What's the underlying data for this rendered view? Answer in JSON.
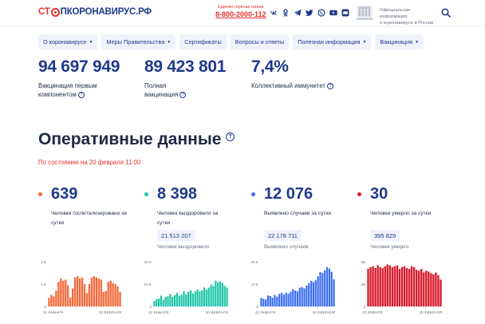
{
  "header": {
    "logo_part1": "СТ",
    "logo_part2": "ПКОРОНАВИРУС.РФ",
    "hotline_label": "Единая горячая линия",
    "hotline_phone": "8-800-2000-112",
    "social_icons": [
      "vk-icon",
      "ok-icon",
      "telegram-icon",
      "twitter-icon",
      "viber-icon",
      "youtube-icon",
      "tiktok-icon"
    ],
    "official_text": "Официальная информация\nо коронавирусе в России"
  },
  "nav": [
    {
      "label": "О коронавирусе",
      "dropdown": true
    },
    {
      "label": "Меры Правительства",
      "dropdown": true
    },
    {
      "label": "Сертификаты",
      "dropdown": false
    },
    {
      "label": "Вопросы и ответы",
      "dropdown": false
    },
    {
      "label": "Полезная информация",
      "dropdown": true
    },
    {
      "label": "Вакцинация",
      "dropdown": true
    }
  ],
  "vaccination": [
    {
      "value": "94 697 949",
      "label": "Вакцинация первым компонентом"
    },
    {
      "value": "89 423 801",
      "label": "Полная вакцинация"
    },
    {
      "value": "7,4%",
      "label": "Коллективный иммунитет"
    }
  ],
  "section": {
    "title": "Оперативные данные",
    "as_of": "По состоянию на 20 февраля 11:00"
  },
  "cards": [
    {
      "value": "639",
      "label": "Человек госпитализировано за сутки",
      "total": "",
      "total_label": "",
      "color": "#f26a3b"
    },
    {
      "value": "8 398",
      "label": "Человек выздоровело за сутки",
      "total": "21 513 207",
      "total_label": "Человек выздоровело",
      "color": "#1fc6a6"
    },
    {
      "value": "12 076",
      "label": "Выявлено случаев за сутки",
      "total": "22 178 711",
      "total_label": "Выявлено случаев",
      "color": "#3d6ff0"
    },
    {
      "value": "30",
      "label": "Человек умерло за сутки",
      "total": "395 829",
      "total_label": "Человек умерло",
      "color": "#d81b2b"
    }
  ],
  "chart_data": [
    {
      "type": "bar",
      "name": "hospitalized",
      "color": "#f26a3b",
      "y_ticks": [
        "2 K",
        "1 K",
        "0"
      ],
      "ylim": [
        0,
        2000
      ],
      "x_labels": [
        "21 ЯНВАРЯ",
        "20 ФЕВРАЛЯ"
      ],
      "values": [
        380,
        520,
        450,
        700,
        1100,
        1250,
        1150,
        1200,
        950,
        400,
        800,
        1300,
        1350,
        1250,
        1300,
        1000,
        600,
        1000,
        1300,
        1350,
        1300,
        1250,
        1200,
        650,
        700,
        1100,
        1150,
        1050,
        1000,
        900,
        639
      ]
    },
    {
      "type": "bar",
      "name": "recovered",
      "color": "#1fc6a6",
      "y_ticks": [
        "20 K",
        "10 K",
        "0"
      ],
      "ylim": [
        0,
        20000
      ],
      "x_labels": [
        "22 ЯНВАРЯ",
        "20 ФЕВРАЛЯ"
      ],
      "values": [
        2500,
        3200,
        3500,
        4800,
        3000,
        4300,
        4500,
        5600,
        4300,
        5000,
        6100,
        4800,
        5200,
        6800,
        5500,
        6500,
        7200,
        5800,
        6800,
        7600,
        6700,
        7200,
        8500,
        7500,
        8400,
        9800,
        9200,
        11500,
        10800,
        11200,
        10500,
        9300,
        8398
      ]
    },
    {
      "type": "bar",
      "name": "cases",
      "color": "#3d6ff0",
      "y_ticks": [
        "20 K",
        "10 K",
        "0"
      ],
      "ylim": [
        0,
        20000
      ],
      "x_labels": [
        "22 ЯНВАРЯ",
        "20 ФЕВРАЛЯ"
      ],
      "values": [
        3800,
        3400,
        3100,
        4900,
        4700,
        3900,
        5100,
        4400,
        5600,
        6100,
        5300,
        6200,
        5700,
        6600,
        7700,
        7100,
        6800,
        8400,
        8700,
        8100,
        9400,
        10400,
        11500,
        10900,
        11700,
        13500,
        15300,
        15000,
        16200,
        17600,
        17000,
        15500,
        12076
      ]
    },
    {
      "type": "bar",
      "name": "deaths",
      "color": "#d81b2b",
      "y_ticks": [
        "50",
        "25",
        "0"
      ],
      "ylim": [
        0,
        50
      ],
      "x_labels": [
        "22 ЯНВАРЯ",
        "20 ФЕВРАЛЯ"
      ],
      "values": [
        42,
        44,
        45,
        43,
        46,
        44,
        43,
        45,
        47,
        46,
        44,
        45,
        46,
        42,
        44,
        45,
        43,
        42,
        45,
        44,
        41,
        40,
        42,
        38,
        40,
        39,
        37,
        36,
        38,
        35,
        30
      ]
    }
  ]
}
